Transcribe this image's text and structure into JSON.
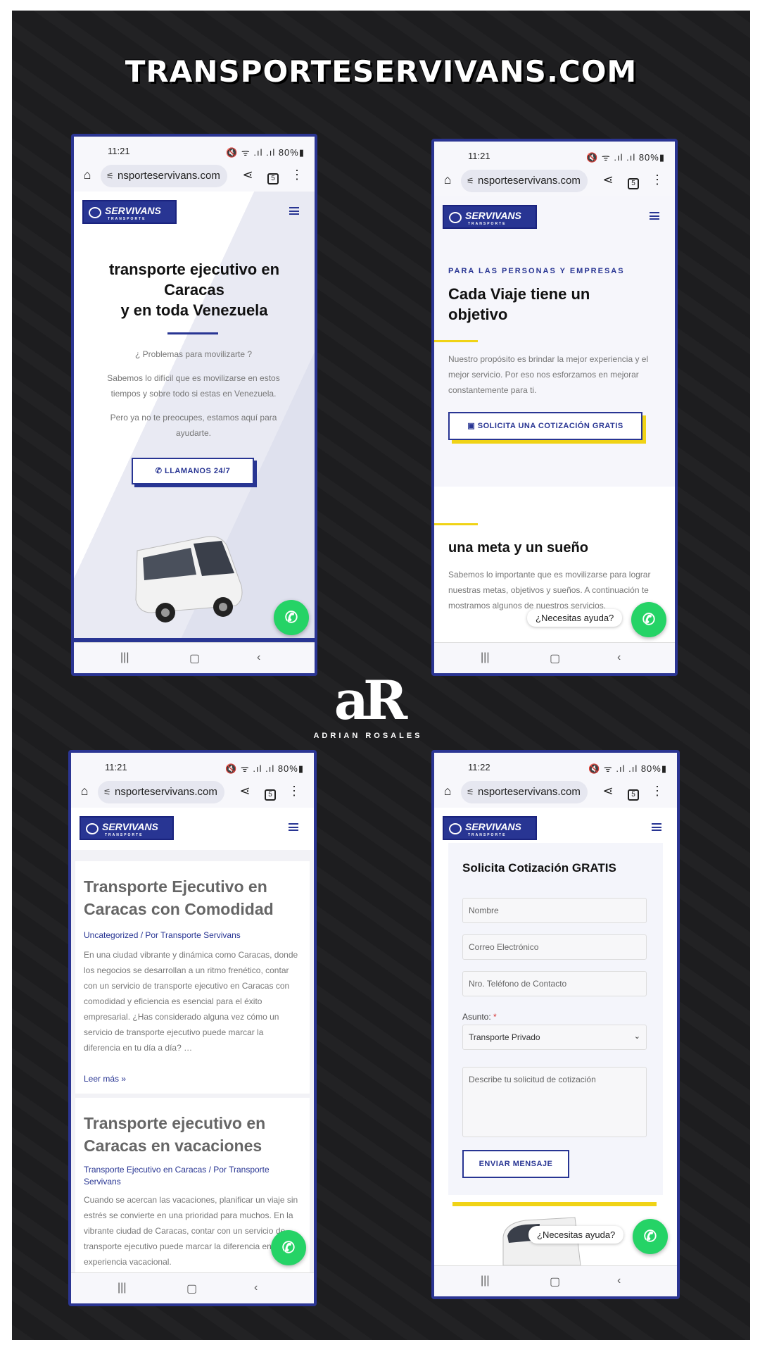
{
  "header": {
    "title": "TRANSPORTESERVIVANS.COM"
  },
  "brand": {
    "monogram": "aR",
    "name": "ADRIAN ROSALES"
  },
  "colors": {
    "navy": "#283593",
    "yellow": "#f0d316",
    "whatsapp": "#25d366",
    "background": "#1d1d1f"
  },
  "site_logo": {
    "text": "SERVIVANS",
    "sub": "TRANSPORTE"
  },
  "phones": [
    {
      "time": "11:21",
      "status_icons": "🔇 ᯤ .ıl .ıl 80%▮",
      "url": "nsporteservivans.com",
      "tabs": "5",
      "hero": {
        "title_l1": "transporte ejecutivo en",
        "title_l2": "Caracas",
        "title_l3": "y en toda Venezuela",
        "question": "¿ Problemas para movilizarte ?",
        "p1": "Sabemos lo difícil que es movilizarse en estos tiempos y sobre todo si estas en Venezuela.",
        "p2": "Pero ya no te preocupes, estamos aquí para ayudarte.",
        "cta": "LLAMANOS 24/7"
      }
    },
    {
      "time": "11:21",
      "status_icons": "🔇 ᯤ .ıl .ıl 80%▮",
      "url": "nsporteservivans.com",
      "tabs": "5",
      "section": {
        "eyebrow": "PARA LAS PERSONAS Y EMPRESAS",
        "title": "Cada Viaje tiene un objetivo",
        "text": "Nuestro propósito  es brindar la mejor experiencia y el mejor servicio. Por eso nos esforzamos en mejorar constantemente para ti.",
        "cta": "SOLICITA UNA COTIZACIÓN GRATIS",
        "title2": "una meta y un sueño",
        "text2": "Sabemos lo importante que es movilizarse para lograr nuestras metas, objetivos y sueños. A continuación te mostramos algunos de nuestros servicios."
      },
      "help": "¿Necesitas ayuda?"
    },
    {
      "time": "11:21",
      "status_icons": "🔇 ᯤ .ıl .ıl 80%▮",
      "url": "nsporteservivans.com",
      "tabs": "5",
      "posts": [
        {
          "title": "Transporte Ejecutivo en Caracas con Comodidad",
          "meta": "Uncategorized / Por Transporte Servivans",
          "excerpt": "En una ciudad vibrante y dinámica como Caracas, donde los negocios se desarrollan a un ritmo frenético, contar con un servicio de transporte ejecutivo en Caracas con comodidad y eficiencia es esencial para el éxito empresarial. ¿Has considerado alguna vez cómo un servicio de transporte ejecutivo puede marcar la diferencia en tu día a día? …",
          "more": "Leer más »"
        },
        {
          "title": "Transporte ejecutivo en Caracas en vacaciones",
          "meta": "Transporte Ejecutivo en Caracas / Por Transporte Servivans",
          "excerpt": "Cuando se acercan las vacaciones, planificar un viaje sin estrés se convierte en una prioridad para muchos. En la vibrante ciudad de Caracas, contar con un servicio de transporte ejecutivo puede marcar la diferencia en tu experiencia vacacional."
        }
      ]
    },
    {
      "time": "11:22",
      "status_icons": "🔇 ᯤ .ıl .ıl 80%▮",
      "url": "nsporteservivans.com",
      "tabs": "5",
      "form": {
        "title": "Solicita Cotización GRATIS",
        "name_ph": "Nombre",
        "email_ph": "Correo Electrónico",
        "phone_ph": "Nro. Teléfono de Contacto",
        "subject_label": "Asunto:",
        "required_mark": "*",
        "subject_value": "Transporte Privado",
        "message_ph": "Describe tu solicitud de cotización",
        "submit": "ENVIAR MENSAJE"
      },
      "help": "¿Necesitas ayuda?"
    }
  ],
  "navbar": {
    "recents": "|||",
    "home": "▢",
    "back": "‹"
  }
}
